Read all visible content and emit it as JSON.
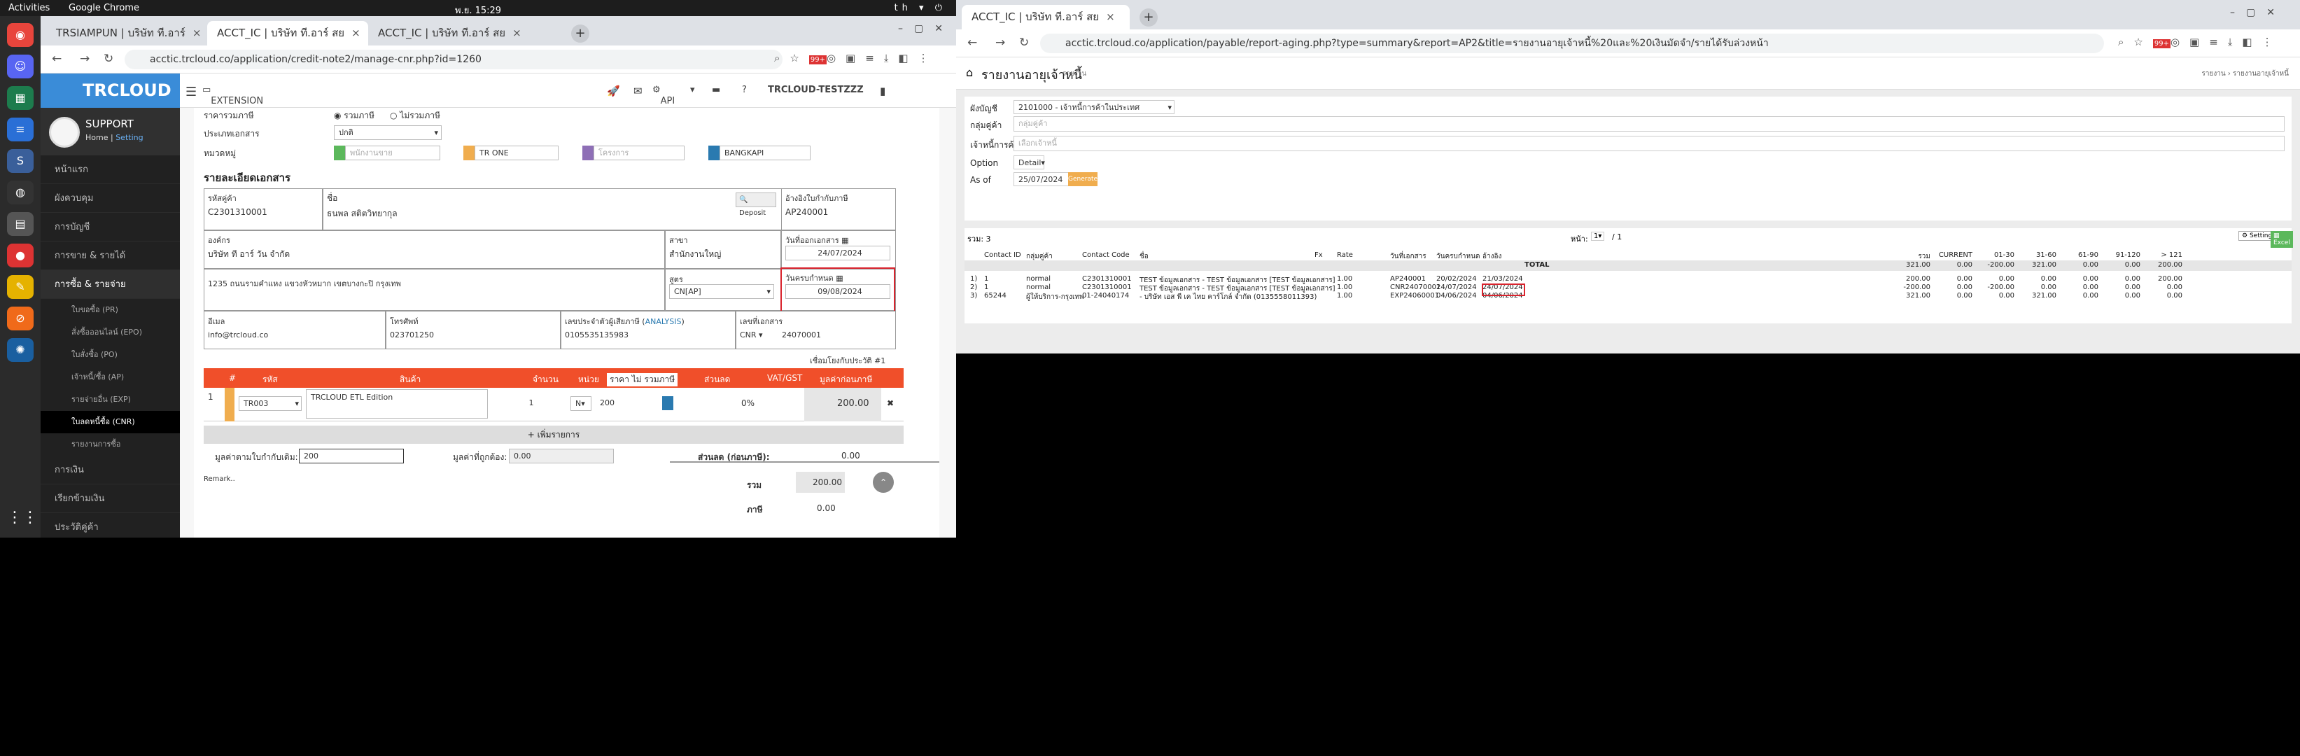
{
  "topbar": {
    "activities": "Activities",
    "app": "Google Chrome",
    "clock": "พ.ย. 15:29",
    "lang": "th"
  },
  "left_window": {
    "tabs": [
      {
        "label": "TRSIAMPUN | บริษัท ที.อาร์"
      },
      {
        "label": "ACCT_IC | บริษัท ที.อาร์ สย"
      },
      {
        "label": "ACCT_IC | บริษัท ที.อาร์ สย"
      }
    ],
    "url": "acctic.trcloud.co/application/credit-note2/manage-cnr.php?id=1260",
    "ext_badge": "99+",
    "brand": "TRCLOUD",
    "profile": {
      "name": "SUPPORT",
      "home": "Home",
      "setting": "Setting"
    },
    "menu": [
      {
        "label": "หน้าแรก",
        "active": false
      },
      {
        "label": "ผังควบคุม",
        "active": false
      },
      {
        "label": "การบัญชี",
        "active": false
      },
      {
        "label": "การขาย & รายได้",
        "active": false
      },
      {
        "label": "การซื้อ & รายจ่าย",
        "active": true
      }
    ],
    "submenu": [
      {
        "label": "ใบขอซื้อ (PR)",
        "active": false
      },
      {
        "label": "สั่งซื้อออนไลน์ (EPO)",
        "active": false
      },
      {
        "label": "ใบสั่งซื้อ (PO)",
        "active": false
      },
      {
        "label": "เจ้าหนี้/ซื้อ (AP)",
        "active": false
      },
      {
        "label": "รายจ่ายอื่น (EXP)",
        "active": false
      },
      {
        "label": "ใบลดหนี้ซื้อ (CNR)",
        "active": true
      },
      {
        "label": "รายงานการซื้อ",
        "active": false
      }
    ],
    "menu2": [
      {
        "label": "การเงิน"
      },
      {
        "label": "เรียกข้ามเงิน"
      },
      {
        "label": "ประวัติคู่ค้า"
      }
    ],
    "header": {
      "extension": "EXTENSION",
      "api": "API",
      "company": "TRCLOUD-TESTZZZ"
    },
    "form": {
      "vat_label": "ราคารวมภาษี",
      "vat_opt1": "รวมภาษี",
      "vat_opt2": "ไม่รวมภาษี",
      "doctype_label": "ประเภทเอกสาร",
      "doctype_value": "ปกติ",
      "group_label": "หมวดหมู่",
      "group1": "พนักงานขาย",
      "group2": "TR ONE",
      "group3": "โครงการ",
      "group4": "BANGKAPI",
      "section": "รายละเอียดเอกสาร",
      "contact_id_label": "รหัสคู่ค้า",
      "contact_id": "C2301310001",
      "name_label": "ชื่อ",
      "name": "ธนพล สติตวิทยากุล",
      "deposit": "Deposit",
      "ref_label": "อ้างอิงใบกำกับภาษี",
      "ref": "AP240001",
      "org_label": "องค์กร",
      "org": "บริษัท ที อาร์ วัน จำกัด",
      "branch_label": "สาขา",
      "branch": "สำนักงานใหญ่",
      "docdate_label": "วันที่ออกเอกสาร",
      "docdate": "24/07/2024",
      "address": "1235 ถนนรามคำแหง แขวงหัวหมาก เขตบางกะปิ กรุงเทพ",
      "formula_label": "สูตร",
      "formula": "CN[AP]",
      "duedate_label": "วันครบกำหนด",
      "duedate": "09/08/2024",
      "email_label": "อีเมล",
      "email": "info@trcloud.co",
      "phone_label": "โทรศัพท์",
      "phone": "023701250",
      "taxid_label": "เลขประจำตัวผู้เสียภาษี",
      "taxid_link": "ANALYSIS",
      "taxid": "0105535135983",
      "docno_label": "เลขที่เอกสาร",
      "docno_prefix": "CNR",
      "docno": "24070001",
      "currency_note": "เชื่อมโยงกับประวัติ #1"
    },
    "items_head": [
      "#",
      "รหัส",
      "สินค้า",
      "จำนวน",
      "หน่วย",
      "ราคา ไม่ รวมภาษี",
      "ส่วนลด",
      "VAT/GST",
      "มูลค่าก่อนภาษี"
    ],
    "item": {
      "no": "1",
      "code": "TR003",
      "name": "TRCLOUD ETL Edition",
      "qty": "1",
      "unit": "N",
      "price": "200",
      "vat": "0%",
      "amount": "200.00"
    },
    "add_item": "+ เพิ่มรายการ",
    "totals": {
      "orig_label": "มูลค่าตามใบกำกับเดิม:",
      "orig_value": "200",
      "correct_label": "มูลค่าที่ถูกต้อง:",
      "correct_value": "0.00",
      "discount_label": "ส่วนลด (ก่อนภาษี):",
      "discount_value": "0.00",
      "sum_label": "รวม",
      "sum_value": "200.00",
      "vat_label": "ภาษี",
      "vat_value": "0.00",
      "remark": "Remark.."
    }
  },
  "right_window": {
    "tabs": [
      {
        "label": "ACCT_IC | บริษัท ที.อาร์ สย"
      }
    ],
    "url": "acctic.trcloud.co/application/payable/report-aging.php?type=summary&report=AP2&title=รายงานอายุเจ้าหนี้%20และ%20เงินมัดจำ/รายได้รับล่วงหน้า",
    "ext_badge": "99+",
    "page_title": "รายงานอายุเจ้าหนี้",
    "page_sub": "รายงาน",
    "breadcrumb": "รายงาน › รายงานอายุเจ้าหนี้",
    "filters": {
      "chart_label": "ผังบัญชี",
      "chart_value": "2101000 - เจ้าหนี้การค้าในประเทศ",
      "group_label": "กลุ่มคู่ค้า",
      "group_ph": "กลุ่มคู่ค้า",
      "creditor_label": "เจ้าหนี้การค้า [AP]",
      "creditor_ph": "เลือกเจ้าหนี้",
      "option_label": "Option",
      "option_value": "Detail",
      "asof_label": "As of",
      "asof_value": "25/07/2024",
      "generate": "Generate"
    },
    "report": {
      "count": "รวม: 3",
      "page_label": "หน้า:",
      "page_value": "1",
      "page_total": "/ 1",
      "setting": "Setting",
      "excel": "Excel",
      "headers": [
        "Contact ID",
        "กลุ่มคู่ค้า",
        "Contact Code",
        "ชื่อ",
        "Fx",
        "Rate",
        "",
        "วันที่เอกสาร",
        "วันครบกำหนด",
        "อ้างอิง",
        "รวม",
        "CURRENT",
        "01-30",
        "31-60",
        "61-90",
        "91-120",
        "> 121"
      ],
      "total_row": {
        "label": "TOTAL",
        "sum": "321.00",
        "current": "0.00",
        "d30": "-200.00",
        "d60": "321.00",
        "d90": "0.00",
        "d120": "0.00",
        "d121": "200.00"
      },
      "rows": [
        {
          "no": "1)",
          "cid": "1",
          "group": "normal",
          "code": "C2301310001",
          "name": "TEST ข้อมูลเอกสาร - TEST ข้อมูลเอกสาร [TEST ข้อมูลเอกสาร]",
          "rate": "1.00",
          "doc": "AP240001",
          "date": "20/02/2024",
          "due": "21/03/2024",
          "ref": "",
          "sum": "200.00",
          "current": "0.00",
          "d30": "0.00",
          "d60": "0.00",
          "d90": "0.00",
          "d120": "0.00",
          "d121": "200.00"
        },
        {
          "no": "2)",
          "cid": "1",
          "group": "normal",
          "code": "C2301310001",
          "name": "TEST ข้อมูลเอกสาร - TEST ข้อมูลเอกสาร [TEST ข้อมูลเอกสาร]",
          "rate": "1.00",
          "doc": "CNR24070001",
          "date": "24/07/2024",
          "due": "24/07/2024",
          "ref": "",
          "sum": "-200.00",
          "current": "0.00",
          "d30": "-200.00",
          "d60": "0.00",
          "d90": "0.00",
          "d120": "0.00",
          "d121": "0.00"
        },
        {
          "no": "3)",
          "cid": "65244",
          "group": "ผู้ให้บริการ-กรุงเทพ",
          "code": "01-24040174",
          "name": "- บริษัท เอส พี เค ไทย คาร์โกล์ จำกัด (0135558011393)",
          "rate": "1.00",
          "doc": "EXP24060001",
          "date": "04/06/2024",
          "due": "04/06/2024",
          "ref": "",
          "sum": "321.00",
          "current": "0.00",
          "d30": "0.00",
          "d60": "321.00",
          "d90": "0.00",
          "d120": "0.00",
          "d121": "0.00"
        }
      ]
    }
  }
}
